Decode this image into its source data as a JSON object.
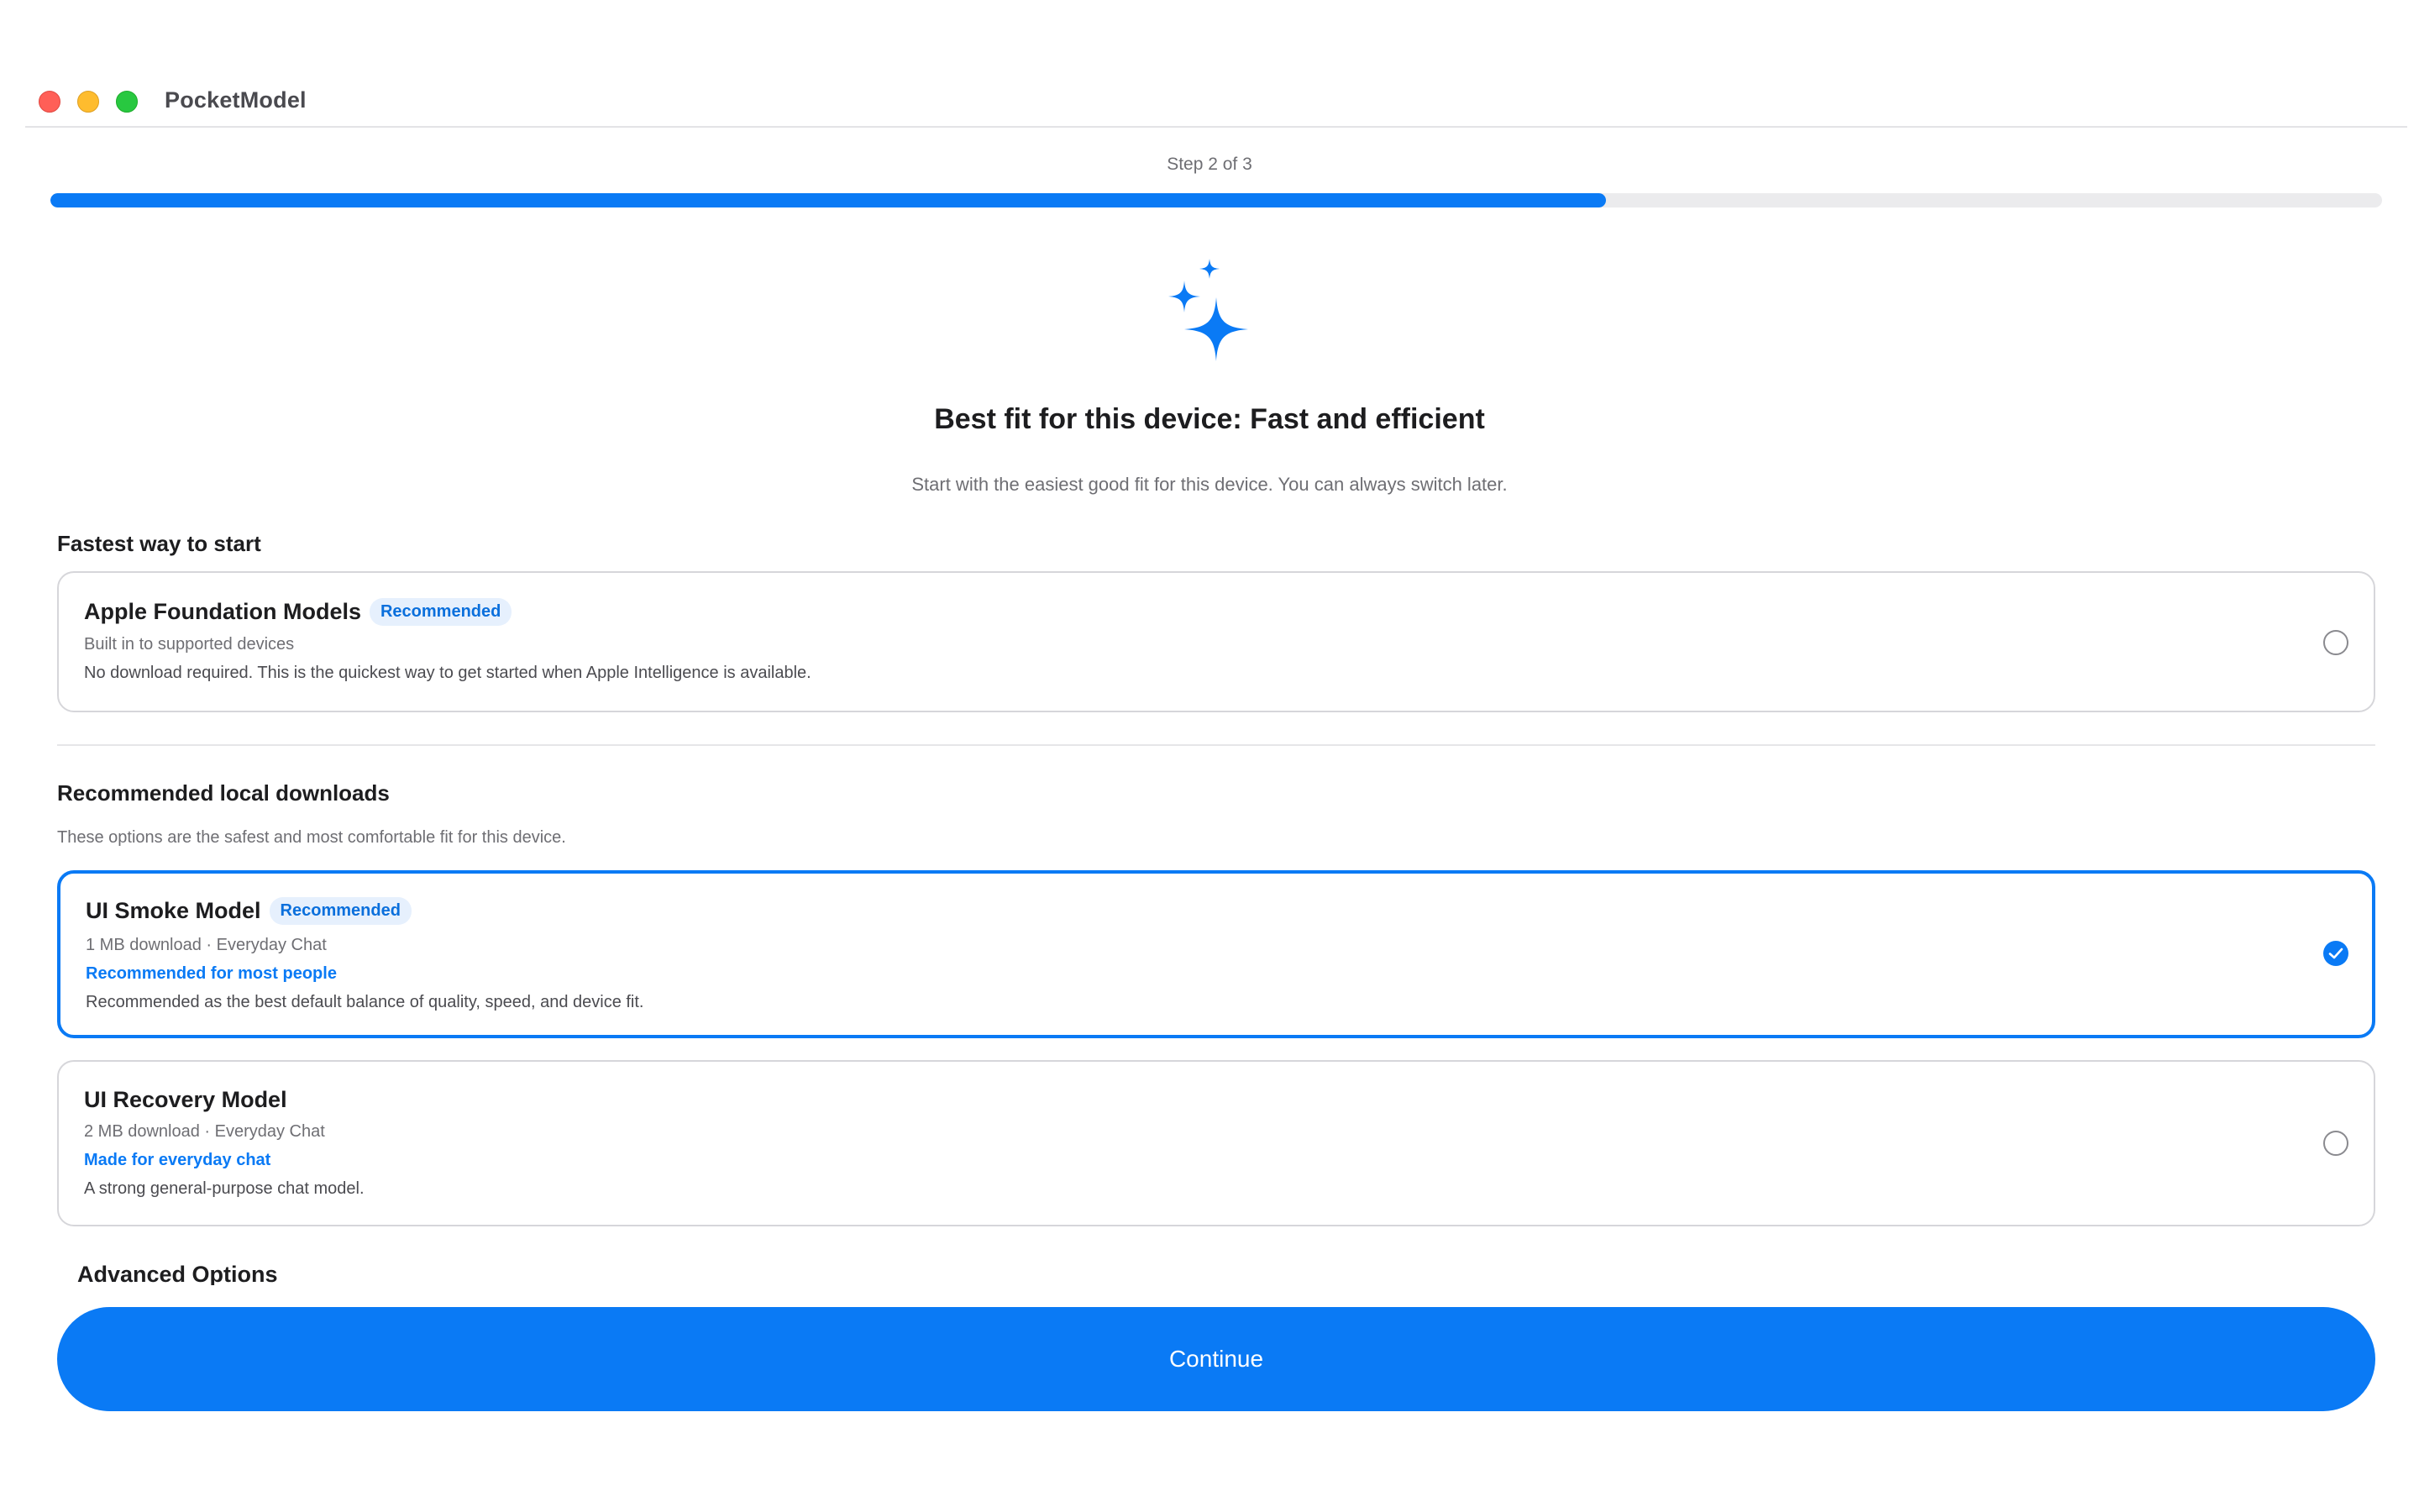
{
  "window": {
    "title": "PocketModel"
  },
  "progress": {
    "step_text": "Step 2 of 3",
    "fraction": 0.667,
    "color": "#0a7af5"
  },
  "hero": {
    "icon": "sparkles-icon",
    "headline": "Best fit for this device: Fast and efficient",
    "subline": "Start with the easiest good fit for this device. You can always switch later."
  },
  "fastest": {
    "title": "Fastest way to start",
    "option": {
      "name": "Apple Foundation Models",
      "badge": "Recommended",
      "line1": "Built in to supported devices",
      "line2": "No download required. This is the quickest way to get started when Apple Intelligence is available.",
      "selected": false
    }
  },
  "downloads": {
    "title": "Recommended local downloads",
    "subtitle": "These options are the safest and most comfortable fit for this device.",
    "options": [
      {
        "name": "UI Smoke Model",
        "badge": "Recommended",
        "meta": "1 MB download · Everyday Chat",
        "highlight": "Recommended for most people",
        "description": "Recommended as the best default balance of quality, speed, and device fit.",
        "selected": true
      },
      {
        "name": "UI Recovery Model",
        "meta": "2 MB download · Everyday Chat",
        "highlight": "Made for everyday chat",
        "description": "A strong general-purpose chat model.",
        "selected": false
      }
    ]
  },
  "advanced": {
    "title": "Advanced Options"
  },
  "actions": {
    "continue_label": "Continue"
  }
}
